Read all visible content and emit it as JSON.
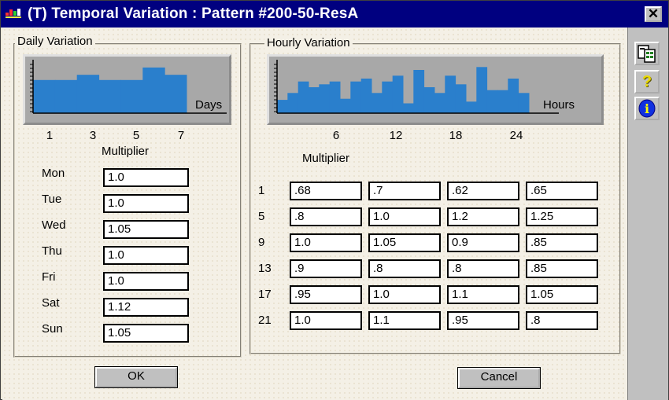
{
  "window": {
    "title": "(T) Temporal Variation : Pattern #200-50-ResA",
    "close_label": "✕"
  },
  "colors": {
    "bar": "#2a7fcc",
    "chart_bg": "#a8a8a8",
    "titlebar": "#000080"
  },
  "daily": {
    "group_title": "Daily Variation",
    "axis_label": "Days",
    "ticks": [
      "1",
      "3",
      "5",
      "7"
    ],
    "multiplier_label": "Multiplier",
    "days": [
      {
        "label": "Mon",
        "value": "1.0"
      },
      {
        "label": "Tue",
        "value": "1.0"
      },
      {
        "label": "Wed",
        "value": "1.05"
      },
      {
        "label": "Thu",
        "value": "1.0"
      },
      {
        "label": "Fri",
        "value": "1.0"
      },
      {
        "label": "Sat",
        "value": "1.12"
      },
      {
        "label": "Sun",
        "value": "1.05"
      }
    ]
  },
  "hourly": {
    "group_title": "Hourly Variation",
    "axis_label": "Hours",
    "ticks": [
      "6",
      "12",
      "18",
      "24"
    ],
    "multiplier_label": "Multiplier",
    "row_labels": [
      "1",
      "5",
      "9",
      "13",
      "17",
      "21"
    ],
    "rows": [
      [
        ".68",
        ".7",
        ".62",
        ".65"
      ],
      [
        ".8",
        "1.0",
        "1.2",
        "1.25"
      ],
      [
        "1.0",
        "1.05",
        "0.9",
        ".85"
      ],
      [
        ".9",
        ".8",
        ".8",
        ".85"
      ],
      [
        ".95",
        "1.0",
        "1.1",
        "1.05"
      ],
      [
        "1.0",
        "1.1",
        ".95",
        ".8"
      ]
    ]
  },
  "buttons": {
    "ok": "OK",
    "cancel": "Cancel"
  },
  "sidebar": {
    "icons": [
      "copy-icon",
      "help-icon",
      "info-icon"
    ],
    "help_glyph": "?",
    "info_glyph": "i"
  },
  "chart_data": [
    {
      "type": "bar",
      "xlabel": "Days",
      "ylabel": "Multiplier",
      "categories": [
        "1",
        "2",
        "3",
        "4",
        "5",
        "6",
        "7"
      ],
      "values": [
        1.0,
        1.0,
        1.05,
        1.0,
        1.0,
        1.12,
        1.05
      ],
      "ylim": [
        0.68,
        1.18
      ]
    },
    {
      "type": "bar",
      "xlabel": "Hours",
      "ylabel": "Multiplier",
      "categories": [
        "1",
        "2",
        "3",
        "4",
        "5",
        "6",
        "7",
        "8",
        "9",
        "10",
        "11",
        "12",
        "13",
        "14",
        "15",
        "16",
        "17",
        "18",
        "19",
        "20",
        "21",
        "22",
        "23",
        "24"
      ],
      "values": [
        0.68,
        0.8,
        1.0,
        0.9,
        0.95,
        1.0,
        0.7,
        1.0,
        1.05,
        0.8,
        1.0,
        1.1,
        0.62,
        1.2,
        0.9,
        0.8,
        1.1,
        0.95,
        0.65,
        1.25,
        0.85,
        0.85,
        1.05,
        0.8
      ],
      "ylim": [
        0.45,
        1.35
      ]
    }
  ]
}
